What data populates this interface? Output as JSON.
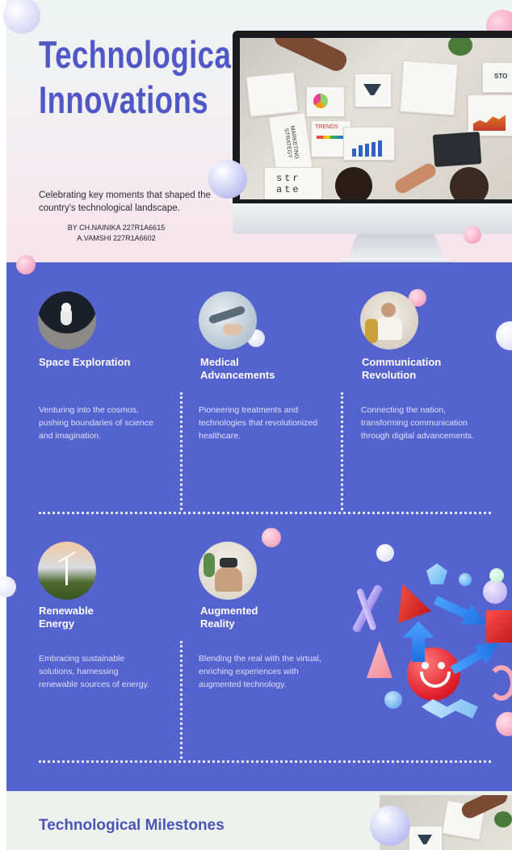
{
  "header": {
    "title_line1": "Technological",
    "title_line2": "Innovations",
    "subtitle": "Celebrating key moments that shaped the country's technological landscape.",
    "byline_line1": "BY CH.NAINIKA 227R1A6615",
    "byline_line2": "A.VAMSHI 227R1A6602"
  },
  "monitor": {
    "screen_texts": [
      "MARKETING STRATEGY",
      "TRENDS",
      "str",
      "ate",
      "STO"
    ]
  },
  "cards": [
    {
      "title": "Space Exploration",
      "description": "Venturing into the cosmos, pushing boundaries of science and imagination.",
      "image": "astronaut-on-moon-image"
    },
    {
      "title": "Medical Advancements",
      "description": "Pioneering treatments and technologies that revolutionized healthcare.",
      "image": "robotic-hand-image"
    },
    {
      "title": "Communication Revolution",
      "description": "Connecting the nation, transforming communication through digital advancements.",
      "image": "woman-on-phone-image"
    },
    {
      "title": "Renewable Energy",
      "description": "Embracing sustainable solutions, harnessing renewable sources of energy.",
      "image": "wind-turbine-image"
    },
    {
      "title": "Augmented Reality",
      "description": "Blending the real with the virtual, enriching experiences with augmented technology.",
      "image": "vr-headset-image"
    }
  ],
  "footer": {
    "title": "Technological Milestones"
  },
  "colors": {
    "accent_blue": "#5563cf",
    "title_blue": "#5058c8",
    "header_bg": "#f3eef1"
  }
}
